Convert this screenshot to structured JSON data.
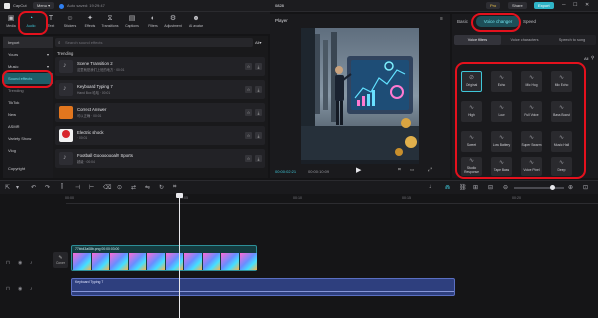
{
  "app": {
    "name": "CapCut",
    "menu_label": "Menu",
    "autosave": "Auto saved: 19:29:47",
    "project_title": "0828"
  },
  "topbar": {
    "pro_label": "Pro",
    "share_label": "Share",
    "export_label": "Export"
  },
  "toolbar": {
    "tools": [
      {
        "label": "Media",
        "icon": "media-icon"
      },
      {
        "label": "Audio",
        "icon": "audio-icon"
      },
      {
        "label": "Text",
        "icon": "text-icon"
      },
      {
        "label": "Stickers",
        "icon": "stickers-icon"
      },
      {
        "label": "Effects",
        "icon": "effects-icon"
      },
      {
        "label": "Transitions",
        "icon": "transitions-icon"
      },
      {
        "label": "Captions",
        "icon": "captions-icon"
      },
      {
        "label": "Filters",
        "icon": "filters-icon"
      },
      {
        "label": "Adjustment",
        "icon": "adjustment-icon"
      },
      {
        "label": "AI avatar",
        "icon": "ai-avatar-icon"
      }
    ]
  },
  "leftnav": {
    "items": [
      "Import",
      "Yours",
      "Music",
      "Sound effects",
      "Trending",
      "TikTok",
      "New",
      "ASMR",
      "Variety Show",
      "Vlog",
      "Copyright"
    ]
  },
  "trending": {
    "search_placeholder": "Search sound effects",
    "filter_label": "All",
    "section_title": "Trending",
    "items": [
      {
        "title": "Scene Transition 2",
        "sub": "这里就是我们上班的地方 · 00:01"
      },
      {
        "title": "Keyboard Typing 7",
        "sub": "Hand Box 哈哈 · 00:01"
      },
      {
        "title": "Correct Answer",
        "sub": "可以正确 · 00:01"
      },
      {
        "title": "Electric shock",
        "sub": "· 00:01"
      },
      {
        "title": "Football Goooooooal!! Sports",
        "sub": "超级 · 00:04"
      }
    ]
  },
  "player": {
    "title": "Player",
    "current_time": "00:00:02:21",
    "total_time": "00:00:10:09"
  },
  "right_panel": {
    "tabs": [
      "Basic",
      "Voice changer",
      "Speed"
    ],
    "subtabs": [
      "Voice filters",
      "Voice characters",
      "Speech to song"
    ],
    "all_label": "All",
    "effects": [
      "Original",
      "Echo",
      "Mic Hog",
      "Mic Echo",
      "High",
      "Low",
      "Full Voice",
      "Bass Boost",
      "Sweet",
      "Low Battery",
      "Super Swarm",
      "Music Hall",
      "Studio Response",
      "Tape Bass",
      "Voice Pixel",
      "Deep"
    ]
  },
  "timeline": {
    "ruler": [
      "00:00",
      "00:05",
      "00:10",
      "00:15",
      "00:20",
      "00:25",
      "00:30"
    ],
    "video_clip_label": "77bb43a08b.png  00:00:03:00",
    "audio_clip_label": "Keyboard Typing 7",
    "cover_label": "Cover"
  }
}
